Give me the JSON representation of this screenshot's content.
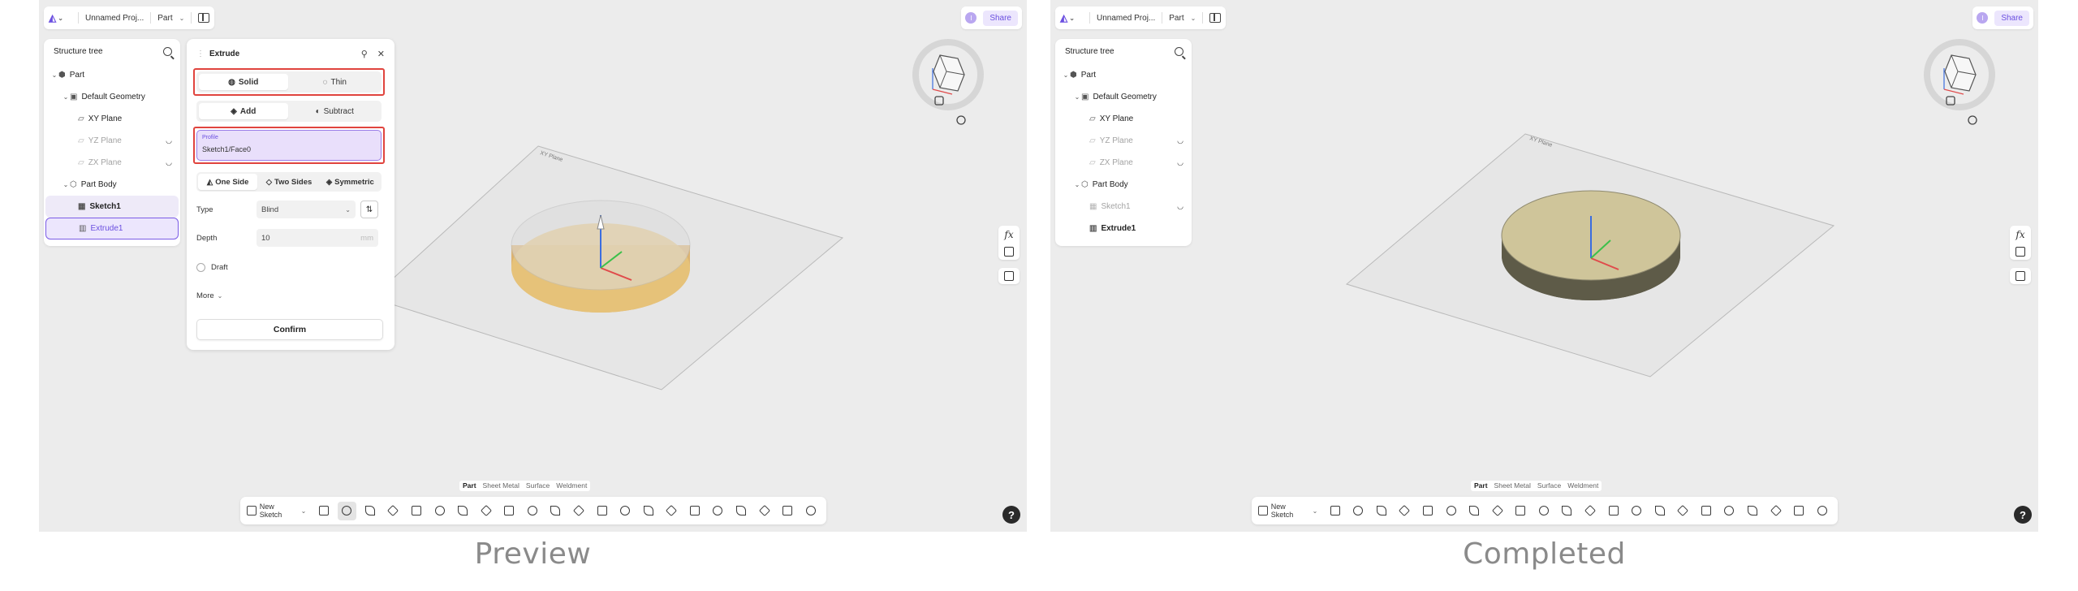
{
  "left": {
    "caption": "Preview",
    "topbar": {
      "project": "Unnamed Proj...",
      "mode": "Part"
    },
    "share": {
      "user_initial": "I",
      "label": "Share"
    },
    "tree": {
      "title": "Structure tree",
      "items": [
        {
          "label": "Part",
          "state": "normal"
        },
        {
          "label": "Default Geometry",
          "state": "normal"
        },
        {
          "label": "XY Plane",
          "state": "normal"
        },
        {
          "label": "YZ Plane",
          "state": "dim"
        },
        {
          "label": "ZX Plane",
          "state": "dim"
        },
        {
          "label": "Part Body",
          "state": "normal"
        },
        {
          "label": "Sketch1",
          "state": "selected"
        },
        {
          "label": "Extrude1",
          "state": "active"
        }
      ]
    },
    "extrude": {
      "title": "Extrude",
      "body_type": {
        "options": [
          "Solid",
          "Thin"
        ],
        "selected": "Solid"
      },
      "operation": {
        "options": [
          "Add",
          "Subtract"
        ],
        "selected": "Add"
      },
      "profile": {
        "label": "Profile",
        "value": "Sketch1/Face0"
      },
      "direction": {
        "options": [
          "One Side",
          "Two Sides",
          "Symmetric"
        ],
        "selected": "One Side"
      },
      "type": {
        "label": "Type",
        "value": "Blind"
      },
      "depth": {
        "label": "Depth",
        "value": "10",
        "unit": "mm"
      },
      "draft": {
        "label": "Draft"
      },
      "more": {
        "label": "More"
      },
      "confirm": "Confirm"
    },
    "plane_label": "XY Plane"
  },
  "right": {
    "caption": "Completed",
    "topbar": {
      "project": "Unnamed Proj...",
      "mode": "Part"
    },
    "share": {
      "user_initial": "I",
      "label": "Share"
    },
    "tree": {
      "title": "Structure tree",
      "items": [
        {
          "label": "Part",
          "state": "normal"
        },
        {
          "label": "Default Geometry",
          "state": "normal"
        },
        {
          "label": "XY Plane",
          "state": "normal"
        },
        {
          "label": "YZ Plane",
          "state": "dim"
        },
        {
          "label": "ZX Plane",
          "state": "dim"
        },
        {
          "label": "Part Body",
          "state": "normal"
        },
        {
          "label": "Sketch1",
          "state": "dim"
        },
        {
          "label": "Extrude1",
          "state": "bold"
        }
      ]
    },
    "plane_label": "XY Plane"
  },
  "mode_tabs": [
    "Part",
    "Sheet Metal",
    "Surface",
    "Weldment"
  ],
  "toolbar": {
    "new_sketch": "New Sketch"
  },
  "rail": {
    "fx": "fx"
  },
  "help": "?",
  "colors": {
    "accent": "#6b4fe0",
    "highlight_box": "#e0443e",
    "preview_disc": "#e8c47a",
    "completed_disc": "#cfc59a"
  }
}
